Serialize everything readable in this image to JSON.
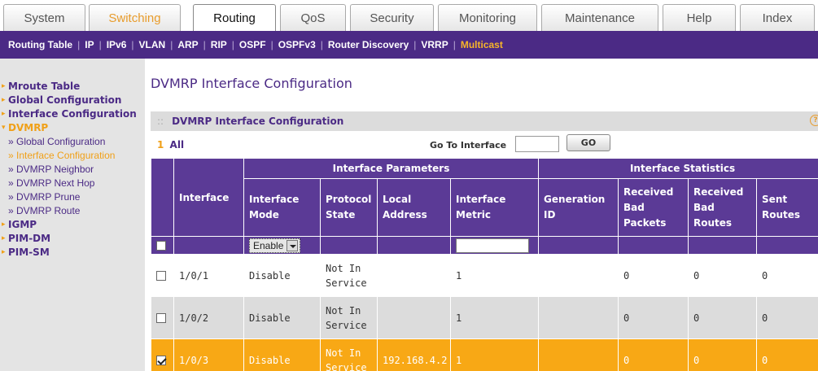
{
  "top_tabs": [
    {
      "label": "System"
    },
    {
      "label": "Switching"
    },
    {
      "label": "Routing"
    },
    {
      "label": "QoS"
    },
    {
      "label": "Security"
    },
    {
      "label": "Monitoring"
    },
    {
      "label": "Maintenance"
    },
    {
      "label": "Help"
    },
    {
      "label": "Index"
    }
  ],
  "subnav": [
    {
      "label": "Routing Table"
    },
    {
      "label": "IP"
    },
    {
      "label": "IPv6"
    },
    {
      "label": "VLAN"
    },
    {
      "label": "ARP"
    },
    {
      "label": "RIP"
    },
    {
      "label": "OSPF"
    },
    {
      "label": "OSPFv3"
    },
    {
      "label": "Router Discovery"
    },
    {
      "label": "VRRP"
    },
    {
      "label": "Multicast"
    }
  ],
  "sidebar": {
    "mroute_table": "Mroute Table",
    "global_configuration": "Global Configuration",
    "interface_configuration": "Interface Configuration",
    "dvmrp": "DVMRP",
    "sub": {
      "global": "» Global Configuration",
      "interface": "» Interface Configuration",
      "neighbor": "» DVMRP Neighbor",
      "next_hop": "» DVMRP Next Hop",
      "prune": "» DVMRP Prune",
      "route": "» DVMRP Route"
    },
    "igmp": "IGMP",
    "pim_dm": "PIM-DM",
    "pim_sm": "PIM-SM"
  },
  "page": {
    "title": "DVMRP Interface Configuration",
    "panel_title": "DVMRP Interface Configuration",
    "help": "?",
    "page_num": "1",
    "page_all": "All",
    "goto_label": "Go To Interface",
    "go_button": "GO"
  },
  "table": {
    "group_params": "Interface Parameters",
    "group_stats": "Interface Statistics",
    "col_interface": "Interface",
    "col_mode": "Interface Mode",
    "col_protocol_state": "Protocol State",
    "col_local_address": "Local Address",
    "col_metric": "Interface Metric",
    "col_generation_id": "Generation ID",
    "col_received_bad_packets": "Received Bad Packets",
    "col_received_bad_routes": "Received Bad Routes",
    "col_sent_routes": "Sent Routes",
    "filter_mode": "Enable",
    "rows": [
      {
        "interface": "1/0/1",
        "mode": "Disable",
        "protocol_state": "Not In Service",
        "local_address": "",
        "metric": "1",
        "generation_id": "",
        "bad_packets": "0",
        "bad_routes": "0",
        "sent_routes": "0",
        "checked": false
      },
      {
        "interface": "1/0/2",
        "mode": "Disable",
        "protocol_state": "Not In Service",
        "local_address": "",
        "metric": "1",
        "generation_id": "",
        "bad_packets": "0",
        "bad_routes": "0",
        "sent_routes": "0",
        "checked": false
      },
      {
        "interface": "1/0/3",
        "mode": "Disable",
        "protocol_state": "Not In Service",
        "local_address": "192.168.4.2",
        "metric": "1",
        "generation_id": "",
        "bad_packets": "0",
        "bad_routes": "0",
        "sent_routes": "0",
        "checked": true
      }
    ]
  },
  "colors": {
    "brand_purple": "#4b2a85",
    "header_purple": "#5b3a96",
    "accent_orange": "#f8a815"
  }
}
